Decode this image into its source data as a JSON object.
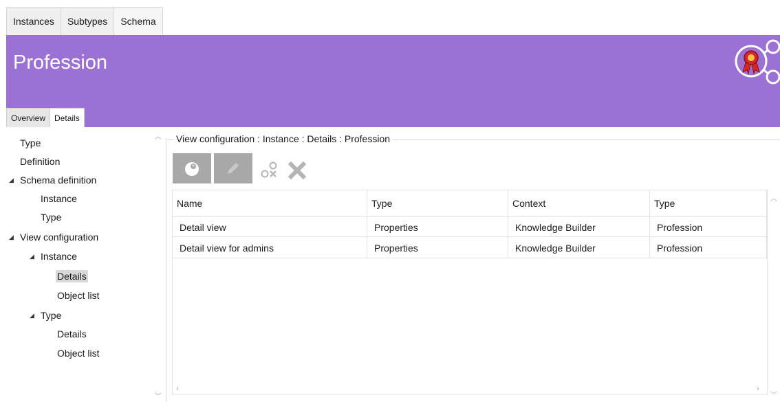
{
  "top_tabs": [
    {
      "label": "Instances"
    },
    {
      "label": "Subtypes"
    },
    {
      "label": "Schema"
    }
  ],
  "header": {
    "title": "Profession",
    "icon": "award-ribbon-network-icon",
    "color": "#9b72d3"
  },
  "sub_tabs": [
    {
      "label": "Overview"
    },
    {
      "label": "Details"
    }
  ],
  "tree": [
    {
      "label": "Type",
      "level": 0
    },
    {
      "label": "Definition",
      "level": 0
    },
    {
      "label": "Schema definition",
      "level": 0,
      "expanded": true
    },
    {
      "label": "Instance",
      "level": 1
    },
    {
      "label": "Type",
      "level": 1
    },
    {
      "label": "View configuration",
      "level": 0,
      "expanded": true
    },
    {
      "label": "Instance",
      "level": 1,
      "expanded": true
    },
    {
      "label": "Details",
      "level": 2,
      "selected": true
    },
    {
      "label": "Object list",
      "level": 2
    },
    {
      "label": "Type",
      "level": 1,
      "expanded": true
    },
    {
      "label": "Details",
      "level": 2
    },
    {
      "label": "Object list",
      "level": 2
    }
  ],
  "group_title": "View configuration : Instance : Details : Profession",
  "toolbar": {
    "new_icon": "new-icon",
    "edit_icon": "pencil-icon",
    "unlink_icon": "unlink-icon",
    "delete_icon": "delete-x-icon"
  },
  "table": {
    "headers": [
      "Name",
      "Type",
      "Context",
      "Type"
    ],
    "rows": [
      [
        "Detail view",
        "Properties",
        "Knowledge Builder",
        "Profession"
      ],
      [
        "Detail view for admins",
        "Properties",
        "Knowledge Builder",
        "Profession"
      ]
    ]
  }
}
